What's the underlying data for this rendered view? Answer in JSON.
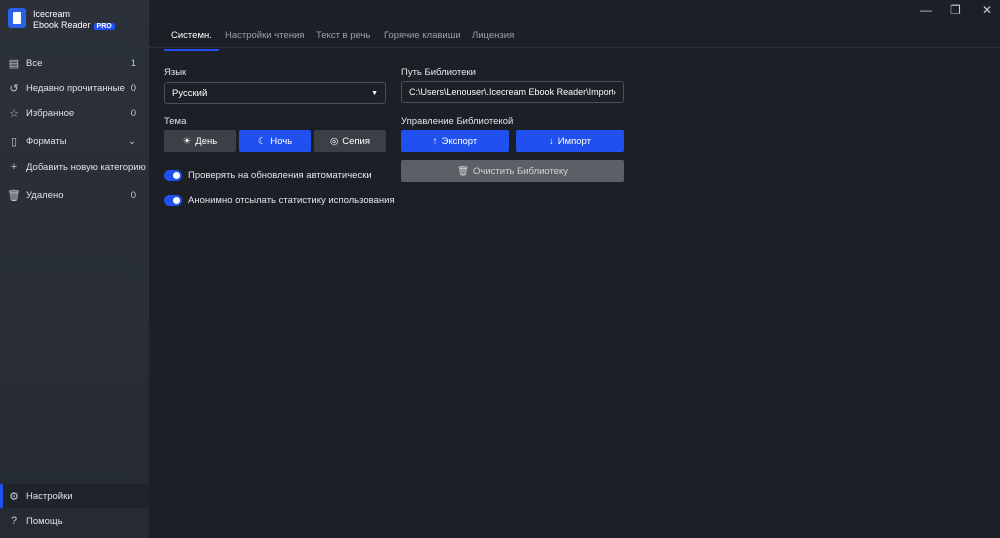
{
  "app": {
    "name_line1": "Icecream",
    "name_line2": "Ebook Reader",
    "badge": "PRO"
  },
  "sidebar": {
    "items": [
      {
        "icon": "book-icon",
        "label": "Все",
        "count": "1"
      },
      {
        "icon": "history-icon",
        "label": "Недавно прочитанные",
        "count": "0"
      },
      {
        "icon": "star-icon",
        "label": "Избранное",
        "count": "0"
      },
      {
        "icon": "file-icon",
        "label": "Форматы",
        "count": ""
      },
      {
        "icon": "plus-icon",
        "label": "Добавить новую категорию",
        "count": ""
      },
      {
        "icon": "trash-icon",
        "label": "Удалено",
        "count": "0"
      }
    ],
    "bottom": [
      {
        "icon": "gear-icon",
        "label": "Настройки"
      },
      {
        "icon": "help-icon",
        "label": "Помощь"
      }
    ]
  },
  "tabs": [
    "Системн.",
    "Настройки чтения",
    "Текст в речь",
    "Горячие клавиши",
    "Лицензия"
  ],
  "settings": {
    "language_label": "Язык",
    "language_value": "Русский",
    "theme_label": "Тема",
    "themes": [
      "День",
      "Ночь",
      "Сепия"
    ],
    "theme_selected": "Ночь",
    "toggles": [
      {
        "label": "Проверять на обновления автоматически",
        "on": true
      },
      {
        "label": "Анонимно отсылать статистику использования",
        "on": true
      }
    ],
    "library_path_label": "Путь Библиотеки",
    "library_path": "C:\\Users\\Lenouser\\.Icecream Ebook Reader\\Import",
    "library_mgmt_label": "Управление Библиотекой",
    "export": "Экспорт",
    "import": "Импорт",
    "clear": "Очистить Библиотеку"
  },
  "colors": {
    "accent": "#2150f0",
    "background": "#1c1f26",
    "sidebar": "#2b3039"
  }
}
